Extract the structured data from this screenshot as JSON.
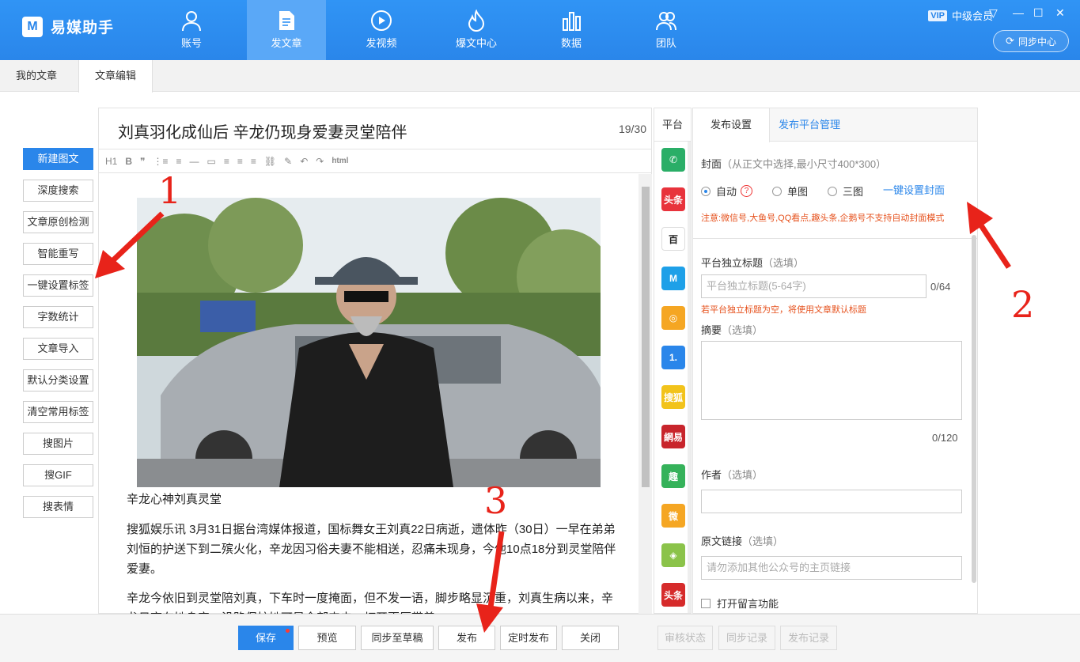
{
  "app": {
    "logo_mark": "M",
    "name": "易媒助手"
  },
  "nav": [
    {
      "label": "账号",
      "icon": "user-icon"
    },
    {
      "label": "发文章",
      "icon": "document-icon",
      "active": true
    },
    {
      "label": "发视频",
      "icon": "play-icon"
    },
    {
      "label": "爆文中心",
      "icon": "flame-icon"
    },
    {
      "label": "数据",
      "icon": "bar-chart-icon"
    },
    {
      "label": "团队",
      "icon": "team-icon"
    }
  ],
  "account": {
    "vip": "VIP",
    "level": "中级会员",
    "sync_label": "同步中心"
  },
  "window": {
    "menu": "▽",
    "minimize": "—",
    "maximize": "☐",
    "close": "✕"
  },
  "tabs": [
    {
      "label": "我的文章"
    },
    {
      "label": "文章编辑",
      "active": true
    }
  ],
  "tools": [
    {
      "label": "新建图文",
      "primary": true
    },
    {
      "label": "深度搜索"
    },
    {
      "label": "文章原创检测"
    },
    {
      "label": "智能重写"
    },
    {
      "label": "一键设置标签"
    },
    {
      "label": "字数统计"
    },
    {
      "label": "文章导入"
    },
    {
      "label": "默认分类设置"
    },
    {
      "label": "清空常用标签"
    },
    {
      "label": "搜图片"
    },
    {
      "label": "搜GIF"
    },
    {
      "label": "搜表情"
    }
  ],
  "editor": {
    "title": "刘真羽化成仙后 辛龙仍现身爱妻灵堂陪伴",
    "title_count": "19/30",
    "toolbar": [
      "H1",
      "B",
      "❞",
      "⋮≡",
      "≡",
      "—",
      "▭",
      "≡",
      "≡",
      "≡",
      "⛓",
      "✎",
      "↶",
      "↷",
      "html"
    ],
    "caption": "辛龙心神刘真灵堂",
    "paragraphs": [
      "搜狐娱乐讯 3月31日据台湾媒体报道，国标舞女王刘真22日病逝，遗体昨（30日）一早在弟弟刘恒的护送下到二殡火化，辛龙因习俗夫妻不能相送，忍痛未现身，今他10点18分到灵堂陪伴爱妻。",
      "辛龙今依旧到灵堂陪刘真，下车时一度掩面，但不发一语，脚步略显沉重，刘真生病以来，辛龙日夜在她身旁，沿路保护她可是全部来去，打开更厚带着，"
    ]
  },
  "platforms": {
    "header": "平台",
    "items": [
      {
        "name": "wechat-icon",
        "text": "✆",
        "color": "#2aae67"
      },
      {
        "name": "toutiao-icon",
        "text": "头条",
        "color": "#e8333c"
      },
      {
        "name": "baijia-icon",
        "text": "百",
        "color": "#ffffff"
      },
      {
        "name": "dayu-icon",
        "text": "M",
        "color": "#1ea0e8"
      },
      {
        "name": "qq-kandian-icon",
        "text": "◎",
        "color": "#f5a623"
      },
      {
        "name": "yidian-icon",
        "text": "1.",
        "color": "#2a86ea"
      },
      {
        "name": "sohu-icon",
        "text": "搜狐",
        "color": "#f2c31b"
      },
      {
        "name": "netease-icon",
        "text": "網易",
        "color": "#c8252c"
      },
      {
        "name": "qutoutiao-icon",
        "text": "趣",
        "color": "#35b25a"
      },
      {
        "name": "weibo-icon",
        "text": "微",
        "color": "#f5a623"
      },
      {
        "name": "qie-icon",
        "text": "◈",
        "color": "#8bc34a"
      },
      {
        "name": "toutiao2-icon",
        "text": "头条",
        "color": "#d62b2b"
      }
    ]
  },
  "settings": {
    "tab_publish": "发布设置",
    "tab_manage": "发布平台管理",
    "cover_label": "封面",
    "cover_hint": "（从正文中选择,最小尺寸400*300）",
    "cover_options": [
      "自动",
      "单图",
      "三图"
    ],
    "cover_help": "?",
    "cover_quick": "一键设置封面",
    "cover_note": "注意:微信号,大鱼号,QQ看点,趣头条,企鹅号不支持自动封面模式",
    "title_label": "平台独立标题",
    "optional": "（选填）",
    "title_placeholder": "平台独立标题(5-64字)",
    "title_count": "0/64",
    "title_note": "若平台独立标题为空，将使用文章默认标题",
    "summary_label": "摘要",
    "summary_count": "0/120",
    "author_label": "作者",
    "source_label": "原文链接",
    "source_placeholder": "请勿添加其他公众号的主页链接",
    "comment_label": "打开留言功能"
  },
  "bottom": {
    "save": "保存",
    "preview": "预览",
    "sync_draft": "同步至草稿",
    "publish": "发布",
    "schedule": "定时发布",
    "close": "关闭",
    "review": "审核状态",
    "sync_record": "同步记录",
    "publish_record": "发布记录"
  },
  "annotations": {
    "n1": "1",
    "n2": "2",
    "n3": "3",
    "color": "#e8231a"
  }
}
